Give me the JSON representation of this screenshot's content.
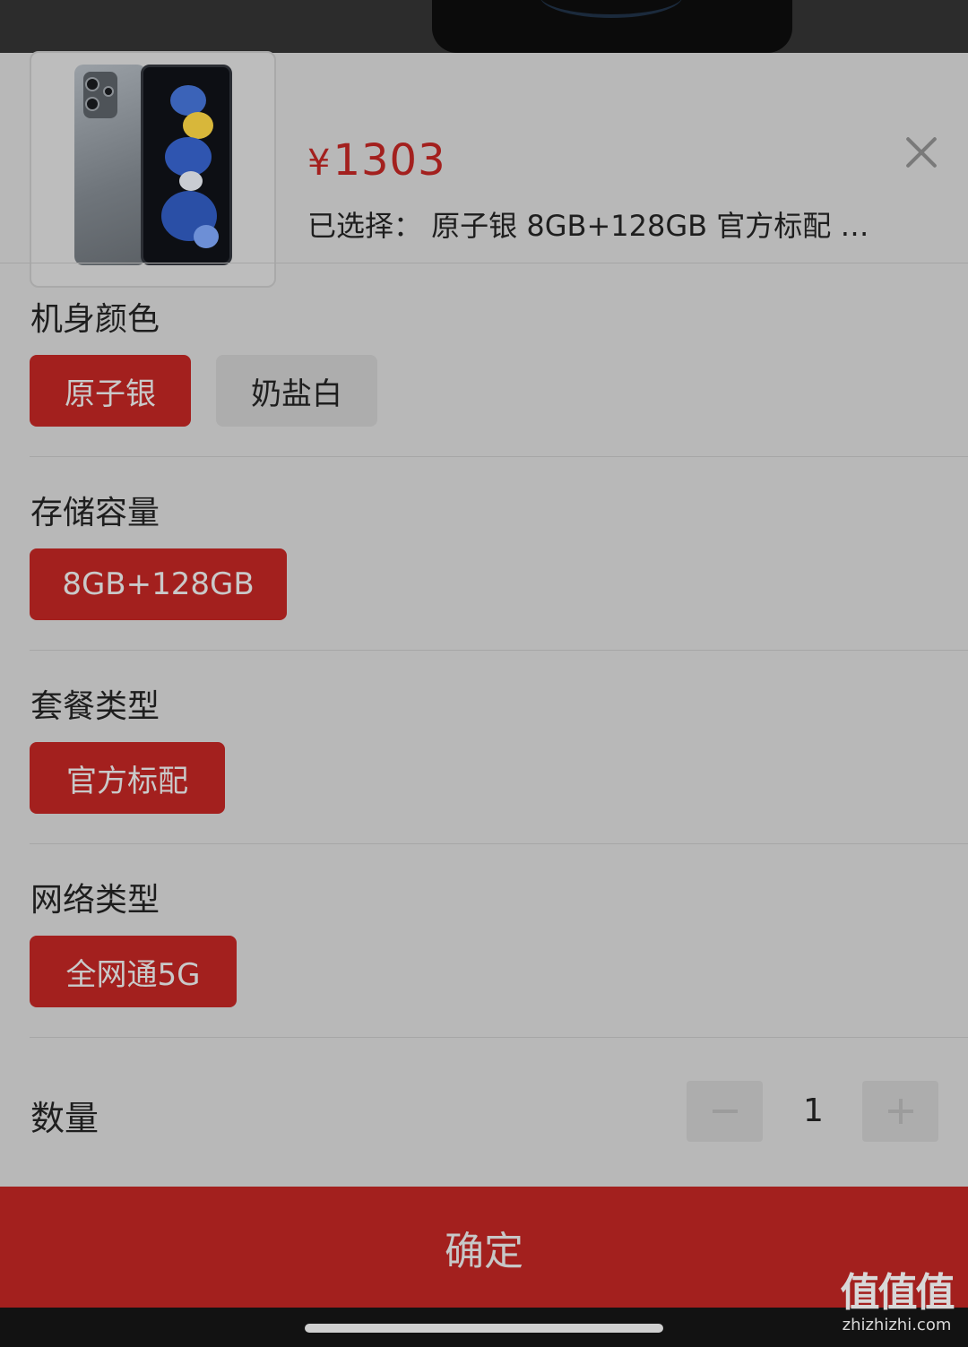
{
  "product": {
    "price_symbol": "¥",
    "price_value": "1303",
    "selected_text": "已选择： 原子银 8GB+128GB 官方标配 …",
    "image_icon": "phone-product-image"
  },
  "sections": {
    "color": {
      "title": "机身颜色",
      "options": [
        "原子银",
        "奶盐白"
      ],
      "selected": "原子银"
    },
    "storage": {
      "title": "存储容量",
      "options": [
        "8GB+128GB"
      ],
      "selected": "8GB+128GB"
    },
    "bundle": {
      "title": "套餐类型",
      "options": [
        "官方标配"
      ],
      "selected": "官方标配"
    },
    "network": {
      "title": "网络类型",
      "options": [
        "全网通5G"
      ],
      "selected": "全网通5G"
    }
  },
  "quantity": {
    "label": "数量",
    "value": "1",
    "minus_icon": "minus-icon",
    "plus_icon": "plus-icon"
  },
  "confirm_label": "确定",
  "watermark": {
    "logo": "值值值",
    "url": "zhizhizhi.com"
  },
  "colors": {
    "accent": "#a3201e",
    "sheet_bg": "#b8b8b8",
    "option_inactive_bg": "#adadad"
  }
}
